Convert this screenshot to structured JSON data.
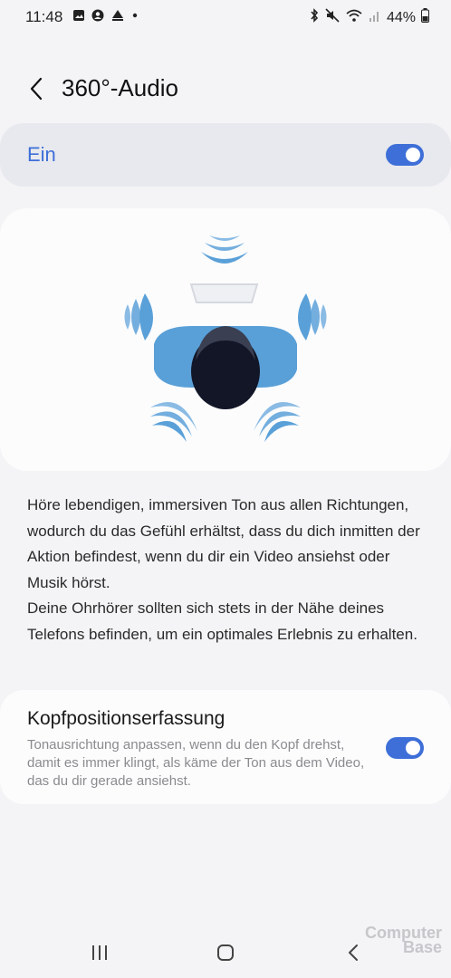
{
  "status_bar": {
    "time": "11:48",
    "battery": "44%",
    "left_icons": [
      "gallery-icon",
      "account-icon",
      "location-alert-icon",
      "dot-icon"
    ],
    "right_icons": [
      "bluetooth-icon",
      "mute-icon",
      "wifi-icon",
      "signal-icon",
      "battery-icon"
    ]
  },
  "header": {
    "title": "360°-Audio"
  },
  "main_toggle": {
    "label": "Ein",
    "state": "on"
  },
  "description": {
    "paragraph1": "Höre lebendigen, immersiven Ton aus allen Richtungen, wodurch du das Gefühl erhältst, dass du dich inmitten der Aktion befindest, wenn du dir ein Video ansiehst oder Musik hörst.",
    "paragraph2": "Deine Ohrhörer sollten sich stets in der Nähe deines Telefons befinden, um ein optimales Erlebnis zu erhalten."
  },
  "head_tracking": {
    "title": "Kopfpositionserfassung",
    "subtitle": "Tonausrichtung anpassen, wenn du den Kopf drehst, damit es immer klingt, als käme der Ton aus dem Video, das du dir gerade ansiehst.",
    "state": "on"
  },
  "nav_bar": {
    "buttons": [
      "recent-apps",
      "home",
      "back"
    ]
  },
  "watermark": {
    "line1": "Computer",
    "line2": "Base"
  },
  "colors": {
    "accent": "#3e6fd8",
    "background": "#f4f4f6",
    "card": "#fcfcfd",
    "illustration_blue": "#5aa0d8",
    "head_dark": "#121627"
  }
}
